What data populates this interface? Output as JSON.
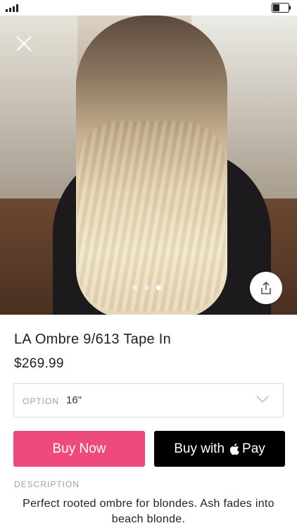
{
  "product": {
    "title": "LA Ombre 9/613 Tape In",
    "price": "$269.99",
    "image_alt": "Long wavy ombre blonde hair at a salon",
    "carousel": {
      "count": 3,
      "active_index": 2
    }
  },
  "option": {
    "label": "OPTION",
    "value": "16\""
  },
  "buttons": {
    "buy_now": "Buy Now",
    "apple_pay_prefix": "Buy with",
    "apple_pay_suffix": "Pay"
  },
  "description": {
    "heading": "DESCRIPTION",
    "text": "Perfect rooted ombre for blondes. Ash fades into beach blonde."
  },
  "icons": {
    "close": "close-icon",
    "share": "share-icon",
    "chevron": "chevron-down-icon",
    "signal": "signal-icon",
    "battery": "battery-icon",
    "apple": "apple-logo-icon"
  },
  "colors": {
    "buy_now_bg": "#ef4a7d",
    "apple_pay_bg": "#000000",
    "muted_label": "#9aa1ad"
  }
}
